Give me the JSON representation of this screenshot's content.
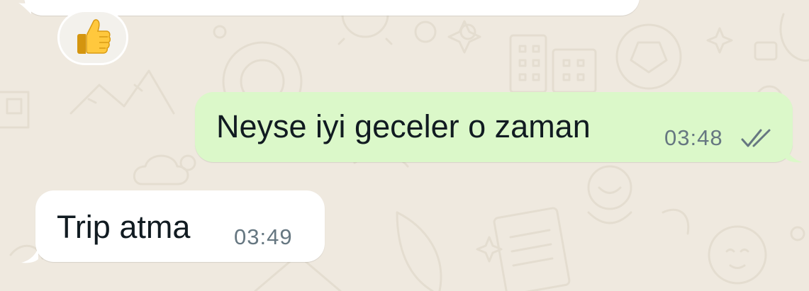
{
  "chat": {
    "reaction": {
      "icon": "thumbs-up-icon"
    },
    "outgoing": {
      "text": "Neyse iyi geceler o zaman",
      "time": "03:48",
      "status_icon": "double-check-icon"
    },
    "incoming": {
      "text": "Trip atma",
      "time": "03:49"
    }
  },
  "colors": {
    "wallpaper": "#efe9df",
    "wallpaper_doodle": "#e3dccf",
    "incoming_bubble": "#ffffff",
    "outgoing_bubble": "#dbf8c9",
    "text": "#111b21",
    "meta": "#667781",
    "thumbs_up": "#ffc83d"
  }
}
